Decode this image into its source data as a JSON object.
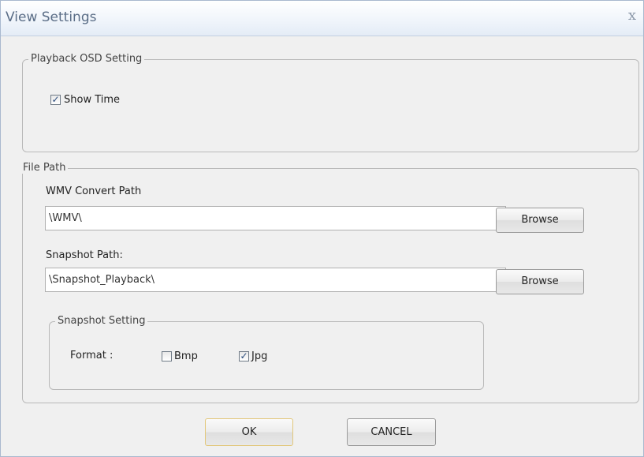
{
  "window": {
    "title": "View Settings",
    "close_glyph": "x"
  },
  "playback_osd": {
    "legend": "Playback OSD Setting",
    "show_time": {
      "label": "Show Time",
      "checked": true
    }
  },
  "file_path": {
    "legend": "File Path",
    "wmv": {
      "label": "WMV Convert Path",
      "value": "\\WMV\\",
      "browse_label": "Browse"
    },
    "snapshot": {
      "label": "Snapshot Path:",
      "value": "\\Snapshot_Playback\\",
      "browse_label": "Browse"
    },
    "snapshot_setting": {
      "legend": "Snapshot Setting",
      "format_label": "Format :",
      "options": [
        {
          "label": "Bmp",
          "checked": false
        },
        {
          "label": "Jpg",
          "checked": true
        }
      ]
    }
  },
  "buttons": {
    "ok": "OK",
    "cancel": "CANCEL"
  },
  "check_glyph": "✓"
}
